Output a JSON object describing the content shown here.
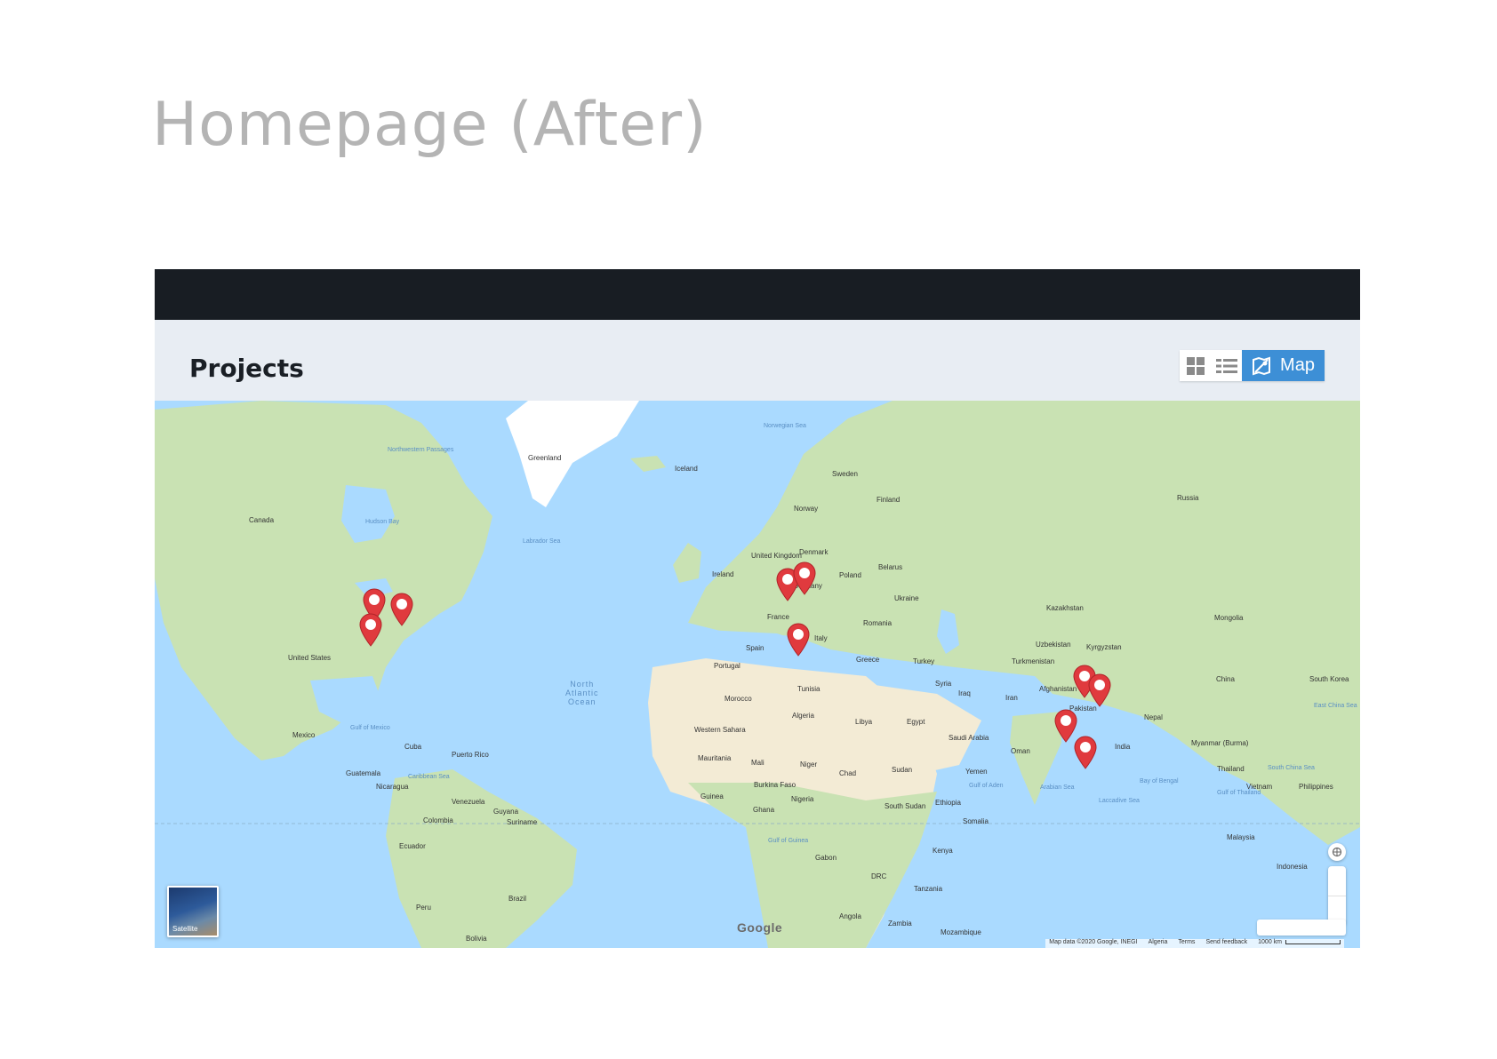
{
  "slide": {
    "title": "Homepage (After)"
  },
  "app": {
    "section_title": "Projects",
    "view_toggle": {
      "grid_icon": "grid-icon",
      "list_icon": "list-icon",
      "map_icon": "map-icon",
      "map_label": "Map",
      "active": "Map"
    }
  },
  "map": {
    "satellite_label": "Satellite",
    "google_logo": "Google",
    "attribution": {
      "data": "Map data ©2020 Google, INEGI",
      "region": "Algeria",
      "terms": "Terms",
      "feedback": "Send feedback",
      "scale": "1000 km"
    },
    "ocean_label": [
      "North",
      "Atlantic",
      "Ocean"
    ],
    "labels": [
      {
        "t": "Greenland",
        "k": "land"
      },
      {
        "t": "Iceland",
        "k": "land"
      },
      {
        "t": "Norwegian Sea",
        "k": "water"
      },
      {
        "t": "Sweden",
        "k": "land"
      },
      {
        "t": "Finland",
        "k": "land"
      },
      {
        "t": "Norway",
        "k": "land"
      },
      {
        "t": "Russia",
        "k": "land"
      },
      {
        "t": "Northwestern Passages",
        "k": "water"
      },
      {
        "t": "Hudson Bay",
        "k": "water"
      },
      {
        "t": "Canada",
        "k": "land"
      },
      {
        "t": "Labrador Sea",
        "k": "water"
      },
      {
        "t": "United Kingdom",
        "k": "land"
      },
      {
        "t": "Ireland",
        "k": "land"
      },
      {
        "t": "Denmark",
        "k": "land"
      },
      {
        "t": "Belarus",
        "k": "land"
      },
      {
        "t": "Germany",
        "k": "land"
      },
      {
        "t": "Poland",
        "k": "land"
      },
      {
        "t": "Ukraine",
        "k": "land"
      },
      {
        "t": "Kazakhstan",
        "k": "land"
      },
      {
        "t": "Mongolia",
        "k": "land"
      },
      {
        "t": "France",
        "k": "land"
      },
      {
        "t": "Italy",
        "k": "land"
      },
      {
        "t": "Romania",
        "k": "land"
      },
      {
        "t": "Spain",
        "k": "land"
      },
      {
        "t": "Portugal",
        "k": "land"
      },
      {
        "t": "Greece",
        "k": "land"
      },
      {
        "t": "Turkey",
        "k": "land"
      },
      {
        "t": "Uzbekistan",
        "k": "land"
      },
      {
        "t": "Kyrgyzstan",
        "k": "land"
      },
      {
        "t": "Turkmenistan",
        "k": "land"
      },
      {
        "t": "China",
        "k": "land"
      },
      {
        "t": "South Korea",
        "k": "land"
      },
      {
        "t": "United States",
        "k": "land"
      },
      {
        "t": "Tunisia",
        "k": "land"
      },
      {
        "t": "Syria",
        "k": "land"
      },
      {
        "t": "Iraq",
        "k": "land"
      },
      {
        "t": "Afghanistan",
        "k": "land"
      },
      {
        "t": "Iran",
        "k": "land"
      },
      {
        "t": "Pakistan",
        "k": "land"
      },
      {
        "t": "Nepal",
        "k": "land"
      },
      {
        "t": "East China Sea",
        "k": "water"
      },
      {
        "t": "Morocco",
        "k": "land"
      },
      {
        "t": "Algeria",
        "k": "land"
      },
      {
        "t": "Libya",
        "k": "land"
      },
      {
        "t": "Egypt",
        "k": "land"
      },
      {
        "t": "Saudi Arabia",
        "k": "land"
      },
      {
        "t": "Oman",
        "k": "land"
      },
      {
        "t": "Western Sahara",
        "k": "land"
      },
      {
        "t": "Mexico",
        "k": "land"
      },
      {
        "t": "Gulf of Mexico",
        "k": "water"
      },
      {
        "t": "Cuba",
        "k": "land"
      },
      {
        "t": "Puerto Rico",
        "k": "land"
      },
      {
        "t": "Mauritania",
        "k": "land"
      },
      {
        "t": "Mali",
        "k": "land"
      },
      {
        "t": "Niger",
        "k": "land"
      },
      {
        "t": "Chad",
        "k": "land"
      },
      {
        "t": "Sudan",
        "k": "land"
      },
      {
        "t": "Yemen",
        "k": "land"
      },
      {
        "t": "Myanmar (Burma)",
        "k": "land"
      },
      {
        "t": "Thailand",
        "k": "land"
      },
      {
        "t": "South China Sea",
        "k": "water"
      },
      {
        "t": "Vietnam",
        "k": "land"
      },
      {
        "t": "Philippines",
        "k": "land"
      },
      {
        "t": "Guatemala",
        "k": "land"
      },
      {
        "t": "Nicaragua",
        "k": "land"
      },
      {
        "t": "Caribbean Sea",
        "k": "water"
      },
      {
        "t": "Venezuela",
        "k": "land"
      },
      {
        "t": "Guyana",
        "k": "land"
      },
      {
        "t": "Suriname",
        "k": "land"
      },
      {
        "t": "Guinea",
        "k": "land"
      },
      {
        "t": "Burkina Faso",
        "k": "land"
      },
      {
        "t": "Ghana",
        "k": "land"
      },
      {
        "t": "Nigeria",
        "k": "land"
      },
      {
        "t": "Gulf of Aden",
        "k": "water"
      },
      {
        "t": "Arabian Sea",
        "k": "water"
      },
      {
        "t": "Bay of Bengal",
        "k": "water"
      },
      {
        "t": "Gulf of Thailand",
        "k": "water"
      },
      {
        "t": "Colombia",
        "k": "land"
      },
      {
        "t": "Ethiopia",
        "k": "land"
      },
      {
        "t": "South Sudan",
        "k": "land"
      },
      {
        "t": "Somalia",
        "k": "land"
      },
      {
        "t": "Laccadive Sea",
        "k": "water"
      },
      {
        "t": "Malaysia",
        "k": "land"
      },
      {
        "t": "Gulf of Guinea",
        "k": "water"
      },
      {
        "t": "Gabon",
        "k": "land"
      },
      {
        "t": "Kenya",
        "k": "land"
      },
      {
        "t": "Ecuador",
        "k": "land"
      },
      {
        "t": "DRC",
        "k": "land"
      },
      {
        "t": "Indonesia",
        "k": "land"
      },
      {
        "t": "Tanzania",
        "k": "land"
      },
      {
        "t": "Peru",
        "k": "land"
      },
      {
        "t": "Brazil",
        "k": "land"
      },
      {
        "t": "Angola",
        "k": "land"
      },
      {
        "t": "Zambia",
        "k": "land"
      },
      {
        "t": "Mozambique",
        "k": "land"
      },
      {
        "t": "Bolivia",
        "k": "land"
      },
      {
        "t": "India",
        "k": "land"
      }
    ],
    "markers": [
      {
        "name": "marker-wisconsin",
        "lat": 43.0,
        "lng": -89.4
      },
      {
        "name": "marker-michigan",
        "lat": 42.3,
        "lng": -83.0
      },
      {
        "name": "marker-missouri",
        "lat": 38.6,
        "lng": -90.2
      },
      {
        "name": "marker-switzerland",
        "lat": 46.5,
        "lng": 7.5
      },
      {
        "name": "marker-austria",
        "lat": 47.5,
        "lng": 11.5
      },
      {
        "name": "marker-tunisia",
        "lat": 36.8,
        "lng": 10.2
      },
      {
        "name": "marker-delhi",
        "lat": 28.6,
        "lng": 77.2
      },
      {
        "name": "marker-lucknow",
        "lat": 26.8,
        "lng": 80.9
      },
      {
        "name": "marker-mumbai",
        "lat": 19.1,
        "lng": 72.9
      },
      {
        "name": "marker-bangalore",
        "lat": 12.97,
        "lng": 77.6
      }
    ],
    "colors": {
      "water": "#aadaff",
      "land": "#c9e2b3",
      "desert": "#f3ebd5",
      "ice": "#ffffff",
      "marker": "#e03a3e"
    }
  }
}
